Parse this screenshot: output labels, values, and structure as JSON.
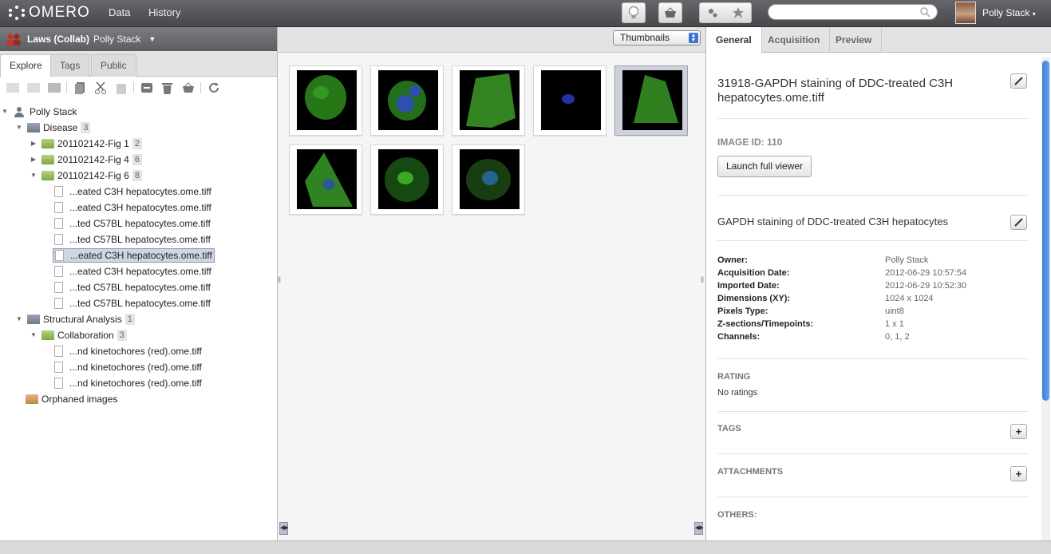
{
  "app": {
    "name": "OMERO",
    "nav": [
      "Data",
      "History"
    ],
    "search_placeholder": "",
    "user": "Polly Stack"
  },
  "group": {
    "name": "Laws (Collab)",
    "owner": "Polly Stack"
  },
  "left_tabs": [
    "Explore",
    "Tags",
    "Public"
  ],
  "tree": {
    "root": "Polly Stack",
    "nodes": [
      {
        "label": "Disease",
        "count": "3"
      },
      {
        "label": "201102142-Fig 1",
        "count": "2"
      },
      {
        "label": "201102142-Fig 4",
        "count": "6"
      },
      {
        "label": "201102142-Fig 6",
        "count": "8"
      },
      {
        "label": "...eated C3H hepatocytes.ome.tiff"
      },
      {
        "label": "...eated C3H hepatocytes.ome.tiff"
      },
      {
        "label": "...ted C57BL hepatocytes.ome.tiff"
      },
      {
        "label": "...ted C57BL hepatocytes.ome.tiff"
      },
      {
        "label": "...eated C3H hepatocytes.ome.tiff"
      },
      {
        "label": "...eated C3H hepatocytes.ome.tiff"
      },
      {
        "label": "...ted C57BL hepatocytes.ome.tiff"
      },
      {
        "label": "...ted C57BL hepatocytes.ome.tiff"
      },
      {
        "label": "Structural Analysis",
        "count": "1"
      },
      {
        "label": "Collaboration",
        "count": "3"
      },
      {
        "label": "...nd kinetochores (red).ome.tiff"
      },
      {
        "label": "...nd kinetochores (red).ome.tiff"
      },
      {
        "label": "...nd kinetochores (red).ome.tiff"
      },
      {
        "label": "Orphaned images"
      }
    ]
  },
  "view_select": "Thumbnails",
  "right_tabs": [
    "General",
    "Acquisition",
    "Preview"
  ],
  "details": {
    "image_name": "31918-GAPDH staining of DDC-treated C3H hepatocytes.ome.tiff",
    "image_id": "IMAGE ID: 110",
    "launch": "Launch full viewer",
    "description": "GAPDH staining of DDC-treated C3H hepatocytes",
    "meta": [
      {
        "k": "Owner:",
        "v": "Polly Stack"
      },
      {
        "k": "Acquisition Date:",
        "v": "2012-06-29 10:57:54"
      },
      {
        "k": "Imported Date:",
        "v": "2012-06-29 10:52:30"
      },
      {
        "k": "Dimensions (XY):",
        "v": "1024 x 1024"
      },
      {
        "k": "Pixels Type:",
        "v": "uint8"
      },
      {
        "k": "Z-sections/Timepoints:",
        "v": "1 x 1"
      },
      {
        "k": "Channels:",
        "v": "0, 1, 2"
      }
    ],
    "rating_label": "RATING",
    "rating_value": "No ratings",
    "tags_label": "TAGS",
    "attachments_label": "ATTACHMENTS",
    "others_label": "OTHERS:"
  },
  "colors": {
    "accent": "#3b7ddc",
    "selection": "#cfd6e3"
  },
  "icons": [
    "omero-logo",
    "lightbulb-icon",
    "basket-icon",
    "settings-icon",
    "scripts-icon",
    "search-icon",
    "folder-icon",
    "copy-icon",
    "cut-icon",
    "paste-icon",
    "remove-icon",
    "delete-icon",
    "trash-icon",
    "refresh-icon",
    "edit-icon",
    "add-icon"
  ]
}
